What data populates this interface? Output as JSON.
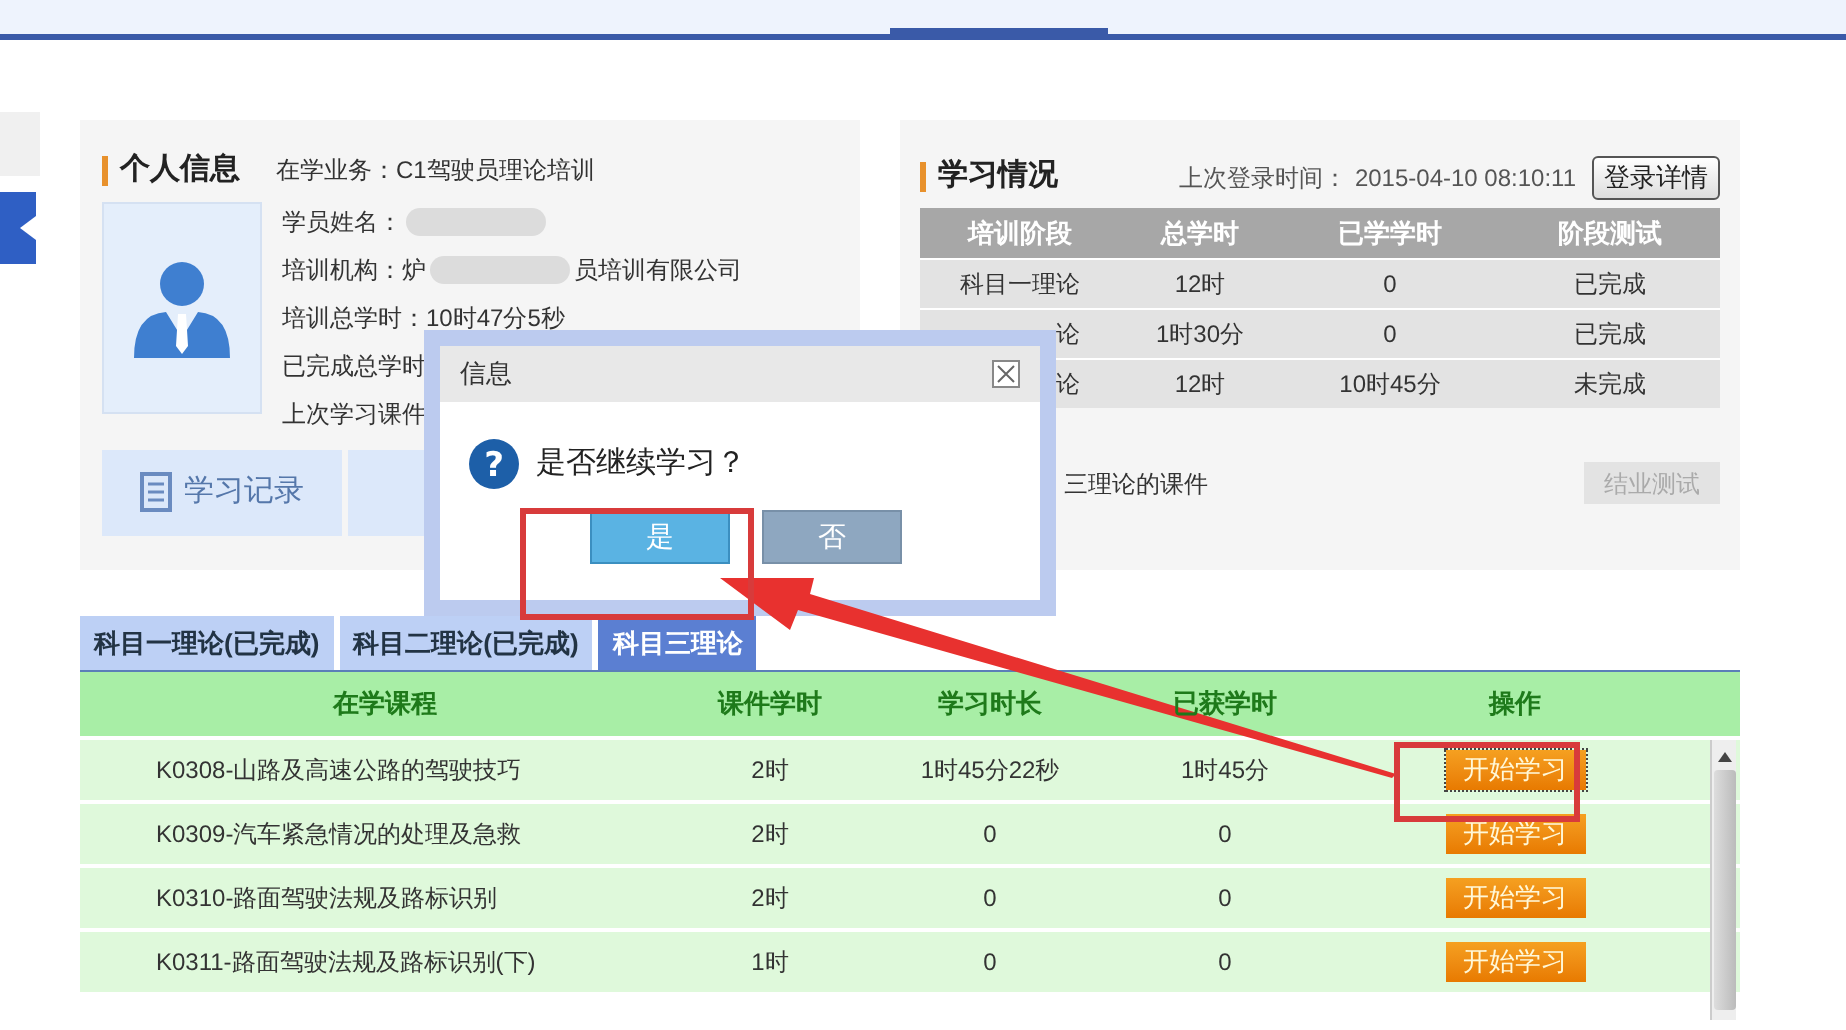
{
  "profile": {
    "title": "个人信息",
    "business": "在学业务：C1驾驶员理论培训",
    "fields": [
      {
        "label": "学员姓名：",
        "blurred": true
      },
      {
        "label": "培训机构：炉",
        "value": "员培训有限公司",
        "blurred": true
      },
      {
        "label": "培训总学时：",
        "value": "10时47分5秒"
      },
      {
        "label": "已完成总学时"
      },
      {
        "label": "上次学习课件"
      }
    ],
    "buttons": [
      {
        "kind": "record",
        "label": "学习记录"
      },
      {
        "kind": "tip"
      }
    ]
  },
  "study_status": {
    "title": "学习情况",
    "last_login_label": "上次登录时间：",
    "last_login": "2015-04-10 08:10:11",
    "details_button": "登录详情",
    "columns": [
      "培训阶段",
      "总学时",
      "已学学时",
      "阶段测试"
    ],
    "rows": [
      [
        "科目一理论",
        "12时",
        "0",
        "已完成"
      ],
      [
        "论",
        "1时30分",
        "0",
        "已完成"
      ],
      [
        "论",
        "12时",
        "10时45分",
        "未完成"
      ]
    ],
    "note": "三理论的课件",
    "test_button": {
      "label": "结业测试",
      "disabled": true
    }
  },
  "tabs": [
    {
      "label": "科目一理论(已完成)",
      "selected": false
    },
    {
      "label": "科目二理论(已完成)",
      "selected": false
    },
    {
      "label": "科目三理论",
      "selected": true
    }
  ],
  "courses": {
    "columns": [
      "在学课程",
      "课件学时",
      "学习时长",
      "已获学时",
      "操作"
    ],
    "rows": [
      {
        "name": "K0308-山路及高速公路的驾驶技巧",
        "hours": "2时",
        "duration": "1时45分22秒",
        "earned": "1时45分",
        "action": "开始学习",
        "focused": true
      },
      {
        "name": "K0309-汽车紧急情况的处理及急救",
        "hours": "2时",
        "duration": "0",
        "earned": "0",
        "action": "开始学习",
        "focused": false
      },
      {
        "name": "K0310-路面驾驶法规及路标识别",
        "hours": "2时",
        "duration": "0",
        "earned": "0",
        "action": "开始学习",
        "focused": false
      },
      {
        "name": "K0311-路面驾驶法规及路标识别(下)",
        "hours": "1时",
        "duration": "0",
        "earned": "0",
        "action": "开始学习",
        "focused": false
      }
    ]
  },
  "dialog": {
    "title": "信息",
    "icon": "?",
    "message": "是否继续学习？",
    "buttons": [
      {
        "label": "是",
        "selected": true
      },
      {
        "label": "否",
        "selected": false
      }
    ]
  }
}
